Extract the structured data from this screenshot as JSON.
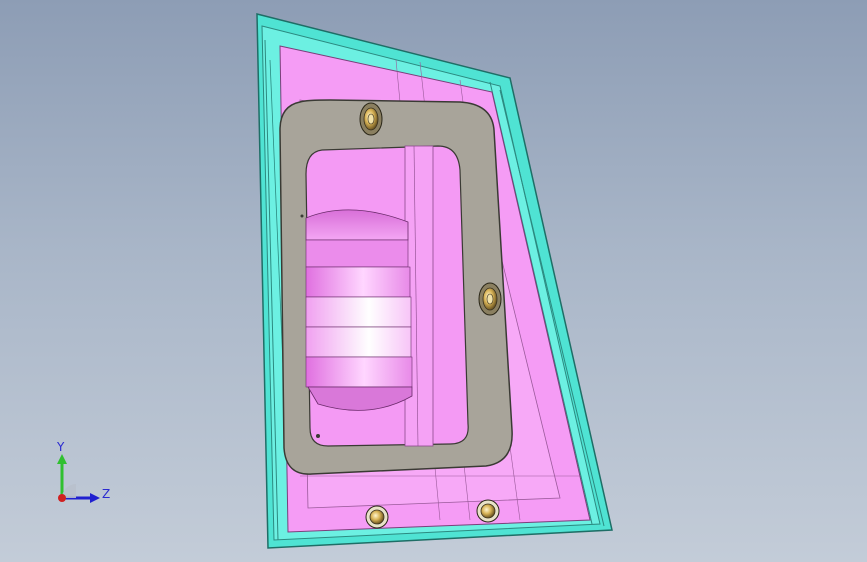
{
  "viewport": {
    "background_top": "#8d9db5",
    "background_bottom": "#c3ccd8"
  },
  "model": {
    "frame_color": "#55e6d6",
    "cavity_color": "#f296f0",
    "gasket_color": "#a8a49a",
    "bolt_color": "#c8a850"
  },
  "triad": {
    "y_label": "Y",
    "z_label": "Z",
    "y_color": "#30c030",
    "z_color": "#2020d0",
    "x_color": "#d02020",
    "y_icon": "arrow-up-icon",
    "z_icon": "arrow-right-icon"
  }
}
